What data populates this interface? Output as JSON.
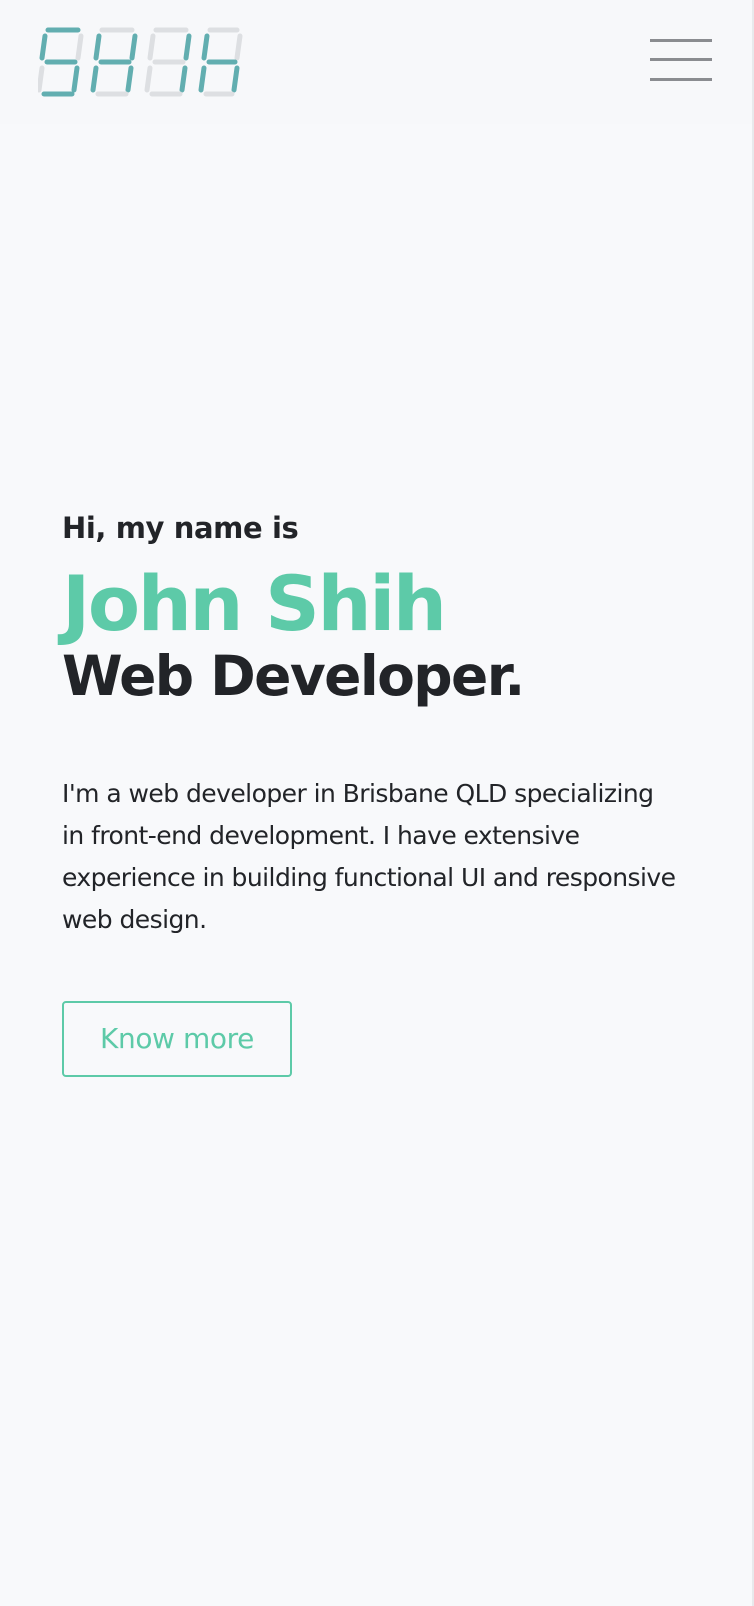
{
  "header": {
    "logo_text": "SHIH",
    "logo_icon": "seven-segment-logo",
    "menu_icon": "hamburger-menu-icon"
  },
  "hero": {
    "greeting": "Hi, my name is",
    "name": "John Shih",
    "role": "Web Developer.",
    "intro": "I'm a web developer in Brisbane QLD specializing in front-end development. I have extensive experience in building functional UI and responsive web design.",
    "cta_label": "Know more"
  },
  "colors": {
    "accent": "#5dcaa8",
    "logo_active": "#62aeb0",
    "logo_inactive": "#dddfe2",
    "text": "#222428",
    "background": "#f8f9fb"
  }
}
